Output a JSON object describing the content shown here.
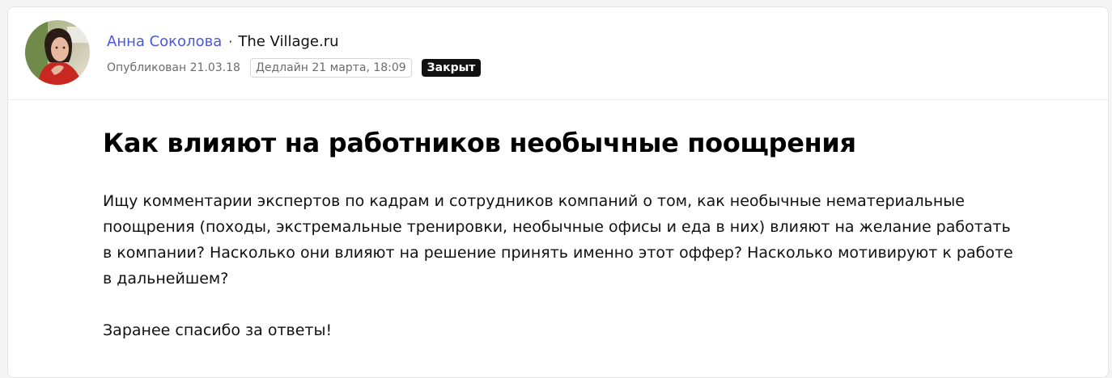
{
  "author": {
    "name": "Анна Соколова",
    "separator": "·",
    "publication": "The Village.ru"
  },
  "meta": {
    "published": "Опубликован 21.03.18",
    "deadline": "Дедлайн 21 марта, 18:09",
    "status": "Закрыт",
    "status_color": "#111111"
  },
  "post": {
    "title": "Как влияют на работников необычные поощрения",
    "body": "Ищу комментарии экспертов по кадрам и сотрудников компаний о том, как необычные нематериальные поощрения (походы, экстремальные тренировки, необычные офисы и еда в них) влияют на желание работать в компании? Насколько они влияют на решение принять именно этот оффер? Насколько мотивируют к работе в дальнейшем?",
    "thanks": "Заранее спасибо за ответы!"
  },
  "colors": {
    "author_link": "#4b57dc"
  }
}
